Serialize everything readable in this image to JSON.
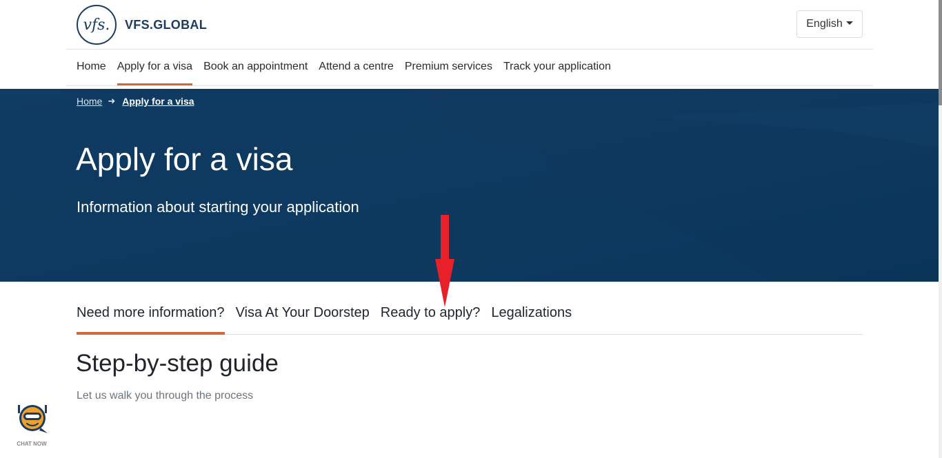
{
  "brand": {
    "logo_mark": "vfs.",
    "name": "VFS.GLOBAL"
  },
  "language": {
    "selected": "English",
    "icon": "caret-down-icon"
  },
  "nav": {
    "items": [
      {
        "label": "Home",
        "active": false
      },
      {
        "label": "Apply for a visa",
        "active": true
      },
      {
        "label": "Book an appointment",
        "active": false
      },
      {
        "label": "Attend a centre",
        "active": false
      },
      {
        "label": "Premium services",
        "active": false
      },
      {
        "label": "Track your application",
        "active": false
      }
    ]
  },
  "breadcrumb": {
    "items": [
      {
        "label": "Home"
      },
      {
        "label": "Apply for a visa"
      }
    ],
    "separator_icon": "arrow-right-icon"
  },
  "hero": {
    "title": "Apply for a visa",
    "subtitle": "Information about starting your application"
  },
  "tabs": {
    "items": [
      {
        "label": "Need more information?",
        "active": true
      },
      {
        "label": "Visa At Your Doorstep",
        "active": false
      },
      {
        "label": "Ready to apply?",
        "active": false
      },
      {
        "label": "Legalizations",
        "active": false
      }
    ]
  },
  "section": {
    "title": "Step-by-step guide",
    "subtitle": "Let us walk you through the process"
  },
  "chat": {
    "label": "CHAT NOW",
    "icon": "chatbot-icon"
  },
  "colors": {
    "brand_navy": "#1c3b5e",
    "hero_bg": "#0c3860",
    "accent_orange": "#d2693a",
    "annotation_red": "#e8202a"
  }
}
